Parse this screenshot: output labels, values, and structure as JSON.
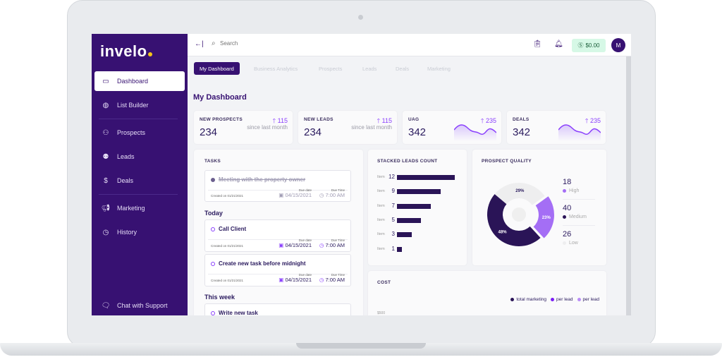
{
  "app": {
    "logo": "invelo"
  },
  "sidebar": {
    "items": [
      {
        "label": "Dashboard",
        "icon": "dashboard-card-icon"
      },
      {
        "label": "List Builder",
        "icon": "globe-icon"
      },
      {
        "label": "Prospects",
        "icon": "user-plus-icon"
      },
      {
        "label": "Leads",
        "icon": "users-icon"
      },
      {
        "label": "Deals",
        "icon": "dollar-circle-icon"
      },
      {
        "label": "Marketing",
        "icon": "megaphone-icon"
      },
      {
        "label": "History",
        "icon": "clock-icon"
      }
    ],
    "support": "Chat with Support"
  },
  "topbar": {
    "search_placeholder": "Search",
    "balance": "$0.00",
    "avatar": "M"
  },
  "tabs": [
    "My Dashboard",
    "Business Analytics",
    "Prospects",
    "Leads",
    "Deals",
    "Marketing"
  ],
  "page_title": "My Dashboard",
  "stats": [
    {
      "label": "NEW PROSPECTS",
      "value": "234",
      "change": "115",
      "sub": "since last month"
    },
    {
      "label": "NEW LEADS",
      "value": "234",
      "change": "115",
      "sub": "since last month"
    },
    {
      "label": "UAG",
      "value": "342",
      "change": "235"
    },
    {
      "label": "DEALS",
      "value": "342",
      "change": "235"
    }
  ],
  "tasks": {
    "title": "TASKS",
    "due_date_label": "Due date",
    "due_time_label": "Due Time",
    "completed": {
      "title": "Meeting with the property owner",
      "created": "Created on 01/21/2021",
      "date": "04/15/2021",
      "time": "7:00 AM"
    },
    "today_label": "Today",
    "today": [
      {
        "title": "Call Client",
        "created": "Created on 01/21/2021",
        "date": "04/15/2021",
        "time": "7:00 AM"
      },
      {
        "title": "Create new task before midnight",
        "created": "Created on 01/21/2021",
        "date": "04/15/2021",
        "time": "7:00 AM"
      }
    ],
    "week_label": "This week",
    "week": [
      {
        "title": "Write new task"
      }
    ]
  },
  "chart_data": [
    {
      "type": "bar",
      "title": "STACKED LEADS COUNT",
      "orientation": "horizontal",
      "categories": [
        "Item",
        "Item",
        "Item",
        "Item",
        "Item",
        "Item"
      ],
      "values": [
        12,
        9,
        7,
        5,
        3,
        1
      ],
      "color": "#2a1457"
    },
    {
      "type": "pie",
      "title": "PROSPECT QUALITY",
      "donut": true,
      "slices": [
        {
          "name": "Low",
          "percent": 29,
          "color": "#eeeeef"
        },
        {
          "name": "High",
          "percent": 23,
          "color": "#a46ef5"
        },
        {
          "name": "Medium",
          "percent": 48,
          "color": "#2a1457"
        }
      ],
      "legend": [
        {
          "value": "18",
          "name": "High",
          "color": "#a46ef5"
        },
        {
          "value": "40",
          "name": "Medium",
          "color": "#2a1457"
        },
        {
          "value": "26",
          "name": "Low",
          "color": "#eeeeef"
        }
      ]
    },
    {
      "type": "line",
      "title": "COST",
      "legend": [
        {
          "name": "total marketing",
          "color": "#2a1457"
        },
        {
          "name": "per lead",
          "color": "#7a1cf5"
        },
        {
          "name": "per lead",
          "color": "#b98cf7"
        }
      ],
      "yticks": [
        "$500"
      ]
    }
  ],
  "colors": {
    "primary": "#371172",
    "accent": "#8a3ffc",
    "balance_bg": "#d6f8e6"
  }
}
